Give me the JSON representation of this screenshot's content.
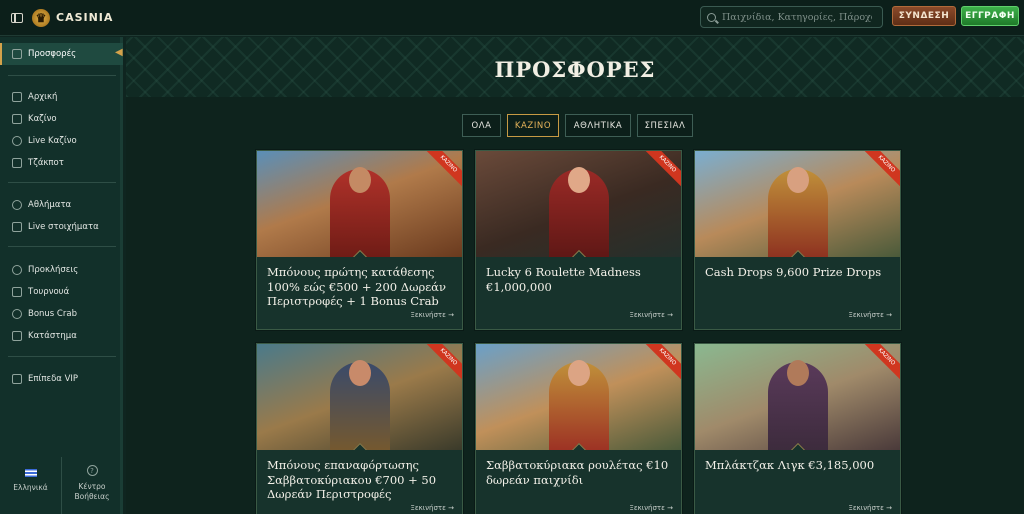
{
  "header": {
    "logo_text": "CASINIA",
    "search_placeholder": "Παιχνίδια, Κατηγορίες, Πάροχοι",
    "login_label": "ΣΥΝΔΕΣΗ",
    "register_label": "ΕΓΓΡΑΦΗ"
  },
  "sidebar": {
    "active_label": "Προσφορές",
    "items": [
      {
        "label": "Αρχική",
        "icon": "home-icon"
      },
      {
        "label": "Καζίνο",
        "icon": "slot-icon"
      },
      {
        "label": "Live Καζίνο",
        "icon": "chip-icon"
      },
      {
        "label": "Τζάκποτ",
        "icon": "jackpot-icon"
      },
      {
        "label": "Αθλήματα",
        "icon": "ball-icon"
      },
      {
        "label": "Live στοιχήματα",
        "icon": "live-icon"
      },
      {
        "label": "Προκλήσεις",
        "icon": "challenge-icon"
      },
      {
        "label": "Τουρνουά",
        "icon": "trophy-icon"
      },
      {
        "label": "Bonus Crab",
        "icon": "crab-icon"
      },
      {
        "label": "Κατάστημα",
        "icon": "shop-icon"
      },
      {
        "label": "Επίπεδα VIP",
        "icon": "crown-icon"
      }
    ],
    "language_label": "Ελληνικά",
    "help_label_1": "Κέντρο",
    "help_label_2": "Βοήθειας"
  },
  "main": {
    "title": "ΠΡΟΣΦΟΡΕΣ",
    "tabs": [
      {
        "label": "ΟΛΑ",
        "active": false
      },
      {
        "label": "ΚΑΖΙΝΟ",
        "active": true
      },
      {
        "label": "ΑΘΛΗΤΙΚΑ",
        "active": false
      },
      {
        "label": "ΣΠΕΣΙΑΛ",
        "active": false
      }
    ],
    "ribbon_label": "ΚΑΖΙΝΟ",
    "cta_label": "Ξεκινήστε →",
    "cards": [
      {
        "title": "Μπόνους πρώτης κατάθεσης 100% εώς €500 + 200 Δωρεάν Περιστροφές + 1 Bonus Crab"
      },
      {
        "title": "Lucky 6 Roulette Madness €1,000,000"
      },
      {
        "title": "Cash Drops 9,600 Prize Drops"
      },
      {
        "title": "Μπόνους επαναφόρτωσης Σαββατοκύριακου €700 + 50 Δωρεάν Περιστροφές"
      },
      {
        "title": "Σαββατοκύριακα ρουλέτας €10 δωρεάν παιχνίδι"
      },
      {
        "title": "Μπλάκτζακ Λιγκ €3,185,000"
      }
    ]
  },
  "colors": {
    "accent_gold": "#d4a24a",
    "ribbon_red": "#d0361f",
    "register_green": "#2f9a3c",
    "login_brown": "#7a3f22"
  }
}
